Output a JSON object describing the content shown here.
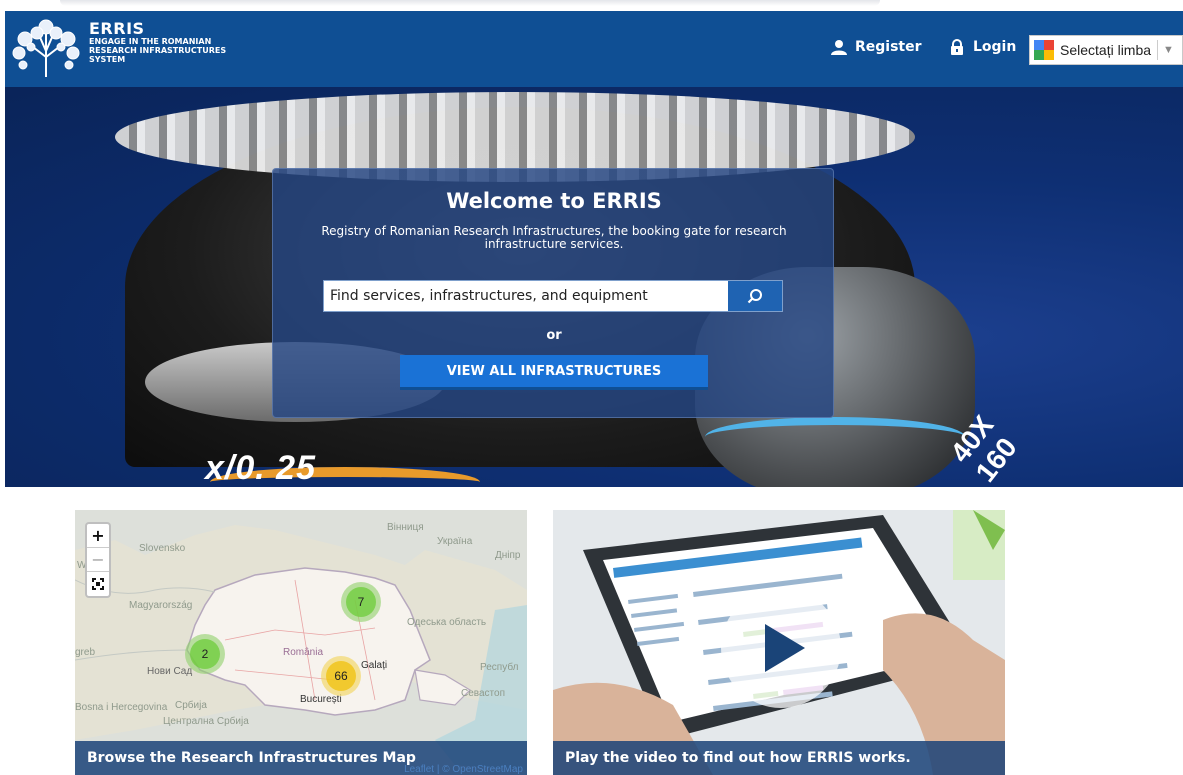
{
  "header": {
    "brand": "ERRIS",
    "tagline_1": "Engage in the Romanian",
    "tagline_2": "Research Infrastructures",
    "tagline_3": "System",
    "register_label": "Register",
    "login_label": "Login",
    "language_select": "Selectați limba"
  },
  "hero": {
    "title": "Welcome to ERRIS",
    "subtitle": "Registry of Romanian Research Infrastructures, the booking gate for research infrastructure services.",
    "search_placeholder": "Find services, infrastructures, and equipment",
    "or_label": "or",
    "view_all_label": "VIEW ALL INFRASTRUCTURES",
    "objective_label": "x/0. 25",
    "objective_label_right": "40X",
    "objective_label_right2": "160"
  },
  "map_card": {
    "caption": "Browse the Research Infrastructures Map",
    "attribution_leaflet": "Leaflet",
    "attribution_osm": "© OpenStreetMap",
    "zoom_in": "+",
    "zoom_out": "−",
    "clusters": [
      {
        "count": "7",
        "color": "green"
      },
      {
        "count": "2",
        "color": "green"
      },
      {
        "count": "66",
        "color": "yellow"
      }
    ],
    "labels": {
      "slovensko": "Slovensko",
      "magyarorszag": "Magyarország",
      "romania": "România",
      "bucuresti": "București",
      "galati": "Galați",
      "vinnytsia": "Вінниця",
      "ukraina": "Україна",
      "dnipro": "Дніпр",
      "odesa": "Одеська область",
      "novisad": "Нови Сад",
      "srbija": "Србија",
      "sevastopol": "Севастоп",
      "bosna": "Bosna i Hercegovina",
      "centralna": "Централна Србија",
      "respublika": "Республ",
      "zagreb": "greb",
      "w": "W"
    }
  },
  "video_card": {
    "caption": "Play the video to find out how ERRIS works."
  },
  "colors": {
    "header_bg": "#0f4f94",
    "accent_button": "#1a72d6",
    "search_button": "#1f63b2",
    "cluster_green": "#6ecc39",
    "cluster_yellow": "#f0c20c"
  }
}
